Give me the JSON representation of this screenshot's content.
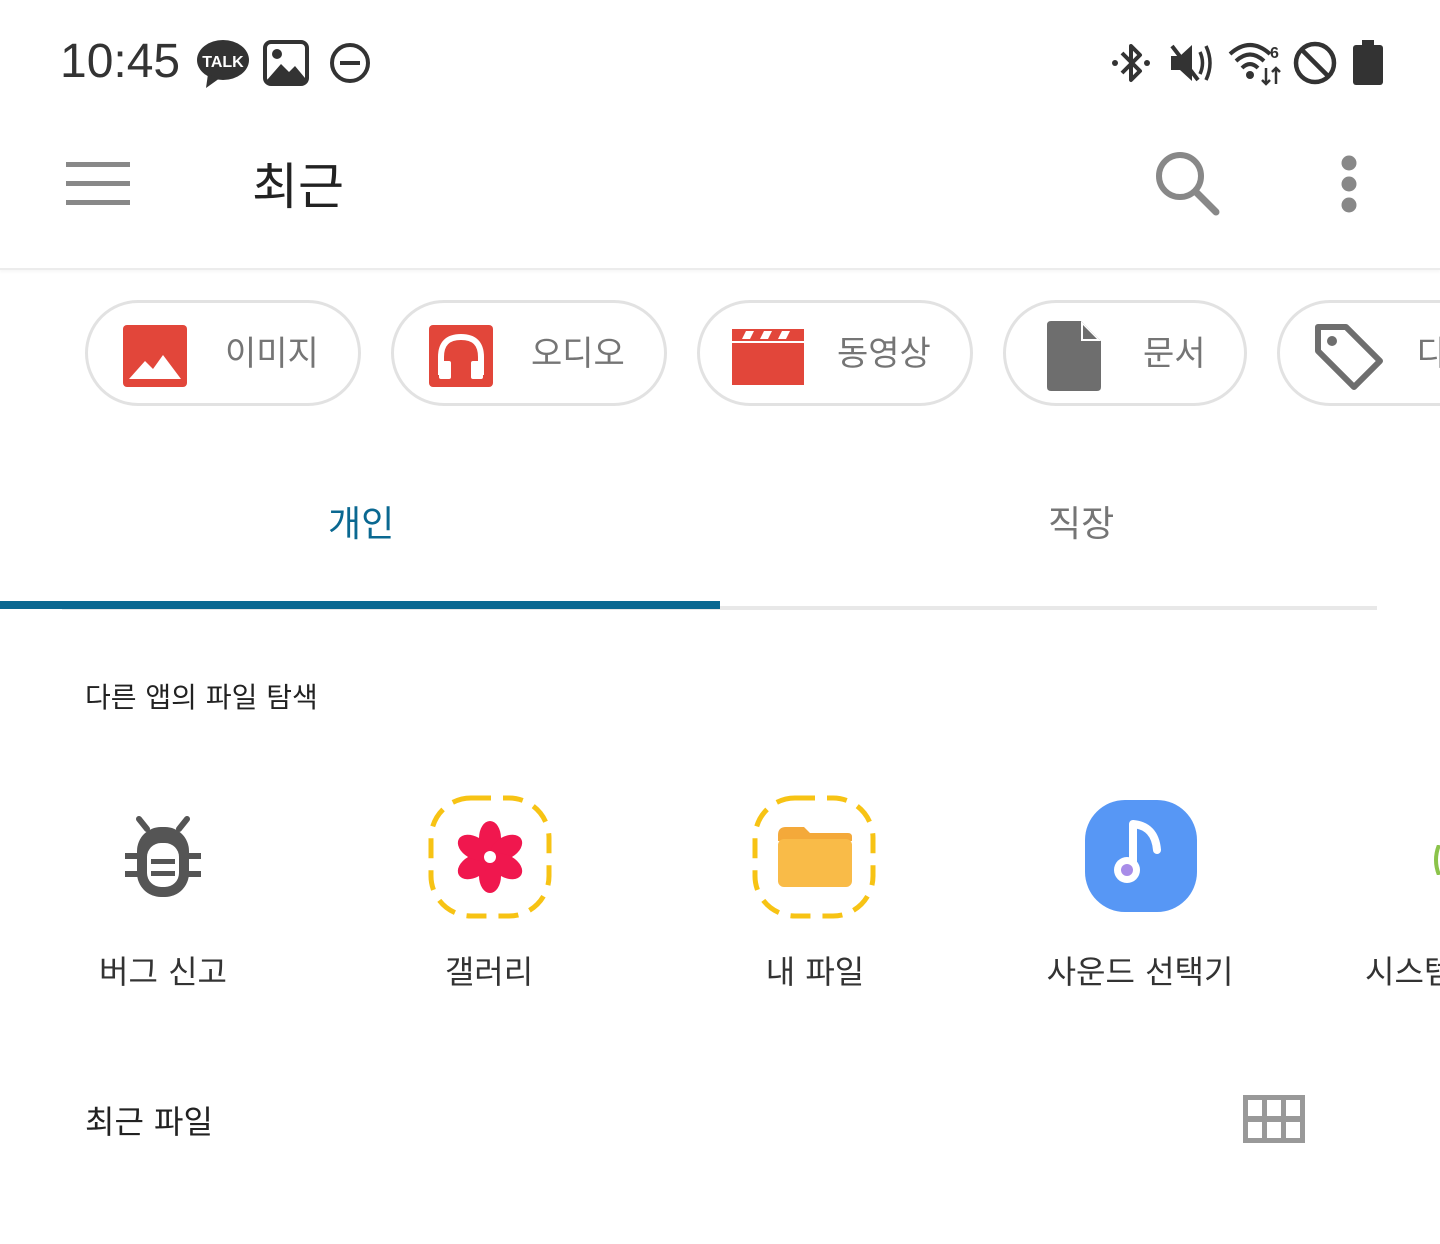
{
  "status_bar": {
    "time": "10:45",
    "left_icons": [
      "kakaotalk-icon",
      "gallery-notification-icon",
      "dnd-icon"
    ],
    "right_icons": [
      "bluetooth-icon",
      "mute-icon",
      "wifi-icon",
      "blocked-icon",
      "battery-icon"
    ],
    "kakao_badge": "TALK",
    "wifi_badge": "6"
  },
  "app_bar": {
    "title": "최근",
    "icons": [
      "menu-icon",
      "search-icon",
      "more-vert-icon"
    ]
  },
  "chips": [
    {
      "label": "이미지",
      "icon": "image-icon",
      "color": "#e2463a"
    },
    {
      "label": "오디오",
      "icon": "audio-icon",
      "color": "#e2463a"
    },
    {
      "label": "동영상",
      "icon": "video-icon",
      "color": "#e2463a"
    },
    {
      "label": "문서",
      "icon": "document-icon",
      "color": "#6e6e6e"
    },
    {
      "label": "다",
      "icon": "tag-icon",
      "color": "#6e6e6e"
    }
  ],
  "tabs": [
    {
      "label": "개인",
      "selected": true,
      "color": "#0a6891"
    },
    {
      "label": "직장",
      "selected": false,
      "color": "#757575"
    }
  ],
  "browse_section": {
    "title": "다른 앱의 파일 탐색",
    "apps": [
      {
        "label": "버그 신고",
        "icon": "bug-icon"
      },
      {
        "label": "갤러리",
        "icon": "gallery-flower-icon"
      },
      {
        "label": "내 파일",
        "icon": "folder-icon"
      },
      {
        "label": "사운드 선택기",
        "icon": "music-note-icon"
      },
      {
        "label": "시스템",
        "icon": "system-app-icon"
      }
    ]
  },
  "recent_section": {
    "title": "최근 파일",
    "icon": "grid-view-icon"
  }
}
